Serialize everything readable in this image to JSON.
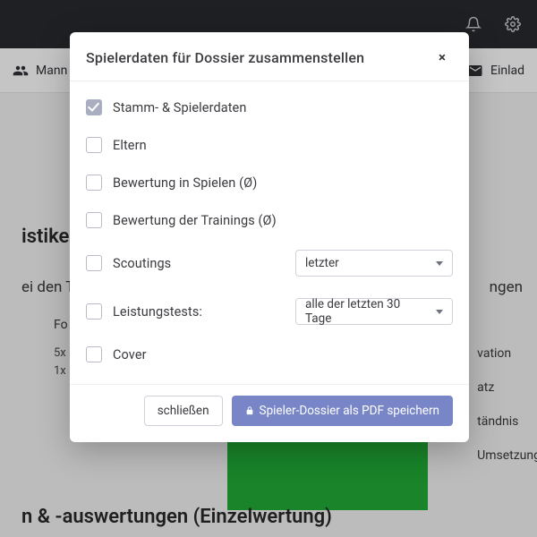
{
  "topbar": {},
  "tabs": {
    "left_label": "Mann",
    "right_label": "Einlad"
  },
  "page": {
    "heading": "istiken &",
    "subline": "ei den T",
    "subline_right": "ngen",
    "small_label": "Fo",
    "small_text": "5x\n1x",
    "right_words_1": "vation",
    "right_words_2": "atz",
    "right_words_3": "tändnis",
    "right_words_4": "Umsetzung",
    "bottom_heading": "n & -auswertungen (Einzelwertung)"
  },
  "modal": {
    "title": "Spielerdaten für Dossier zusammenstellen",
    "close_glyph": "×",
    "options": {
      "stamm": {
        "label": "Stamm- & Spielerdaten",
        "checked": true
      },
      "eltern": {
        "label": "Eltern",
        "checked": false
      },
      "bew_spiele": {
        "label": "Bewertung in Spielen (Ø)",
        "checked": false
      },
      "bew_training": {
        "label": "Bewertung der Trainings (Ø)",
        "checked": false
      },
      "scoutings": {
        "label": "Scoutings",
        "checked": false,
        "select": "letzter"
      },
      "leistungstests": {
        "label": "Leistungstests:",
        "checked": false,
        "select": "alle der letzten 30 Tage"
      },
      "cover": {
        "label": "Cover",
        "checked": false
      }
    },
    "buttons": {
      "close": "schließen",
      "save": "Spieler-Dossier als PDF speichern"
    }
  }
}
